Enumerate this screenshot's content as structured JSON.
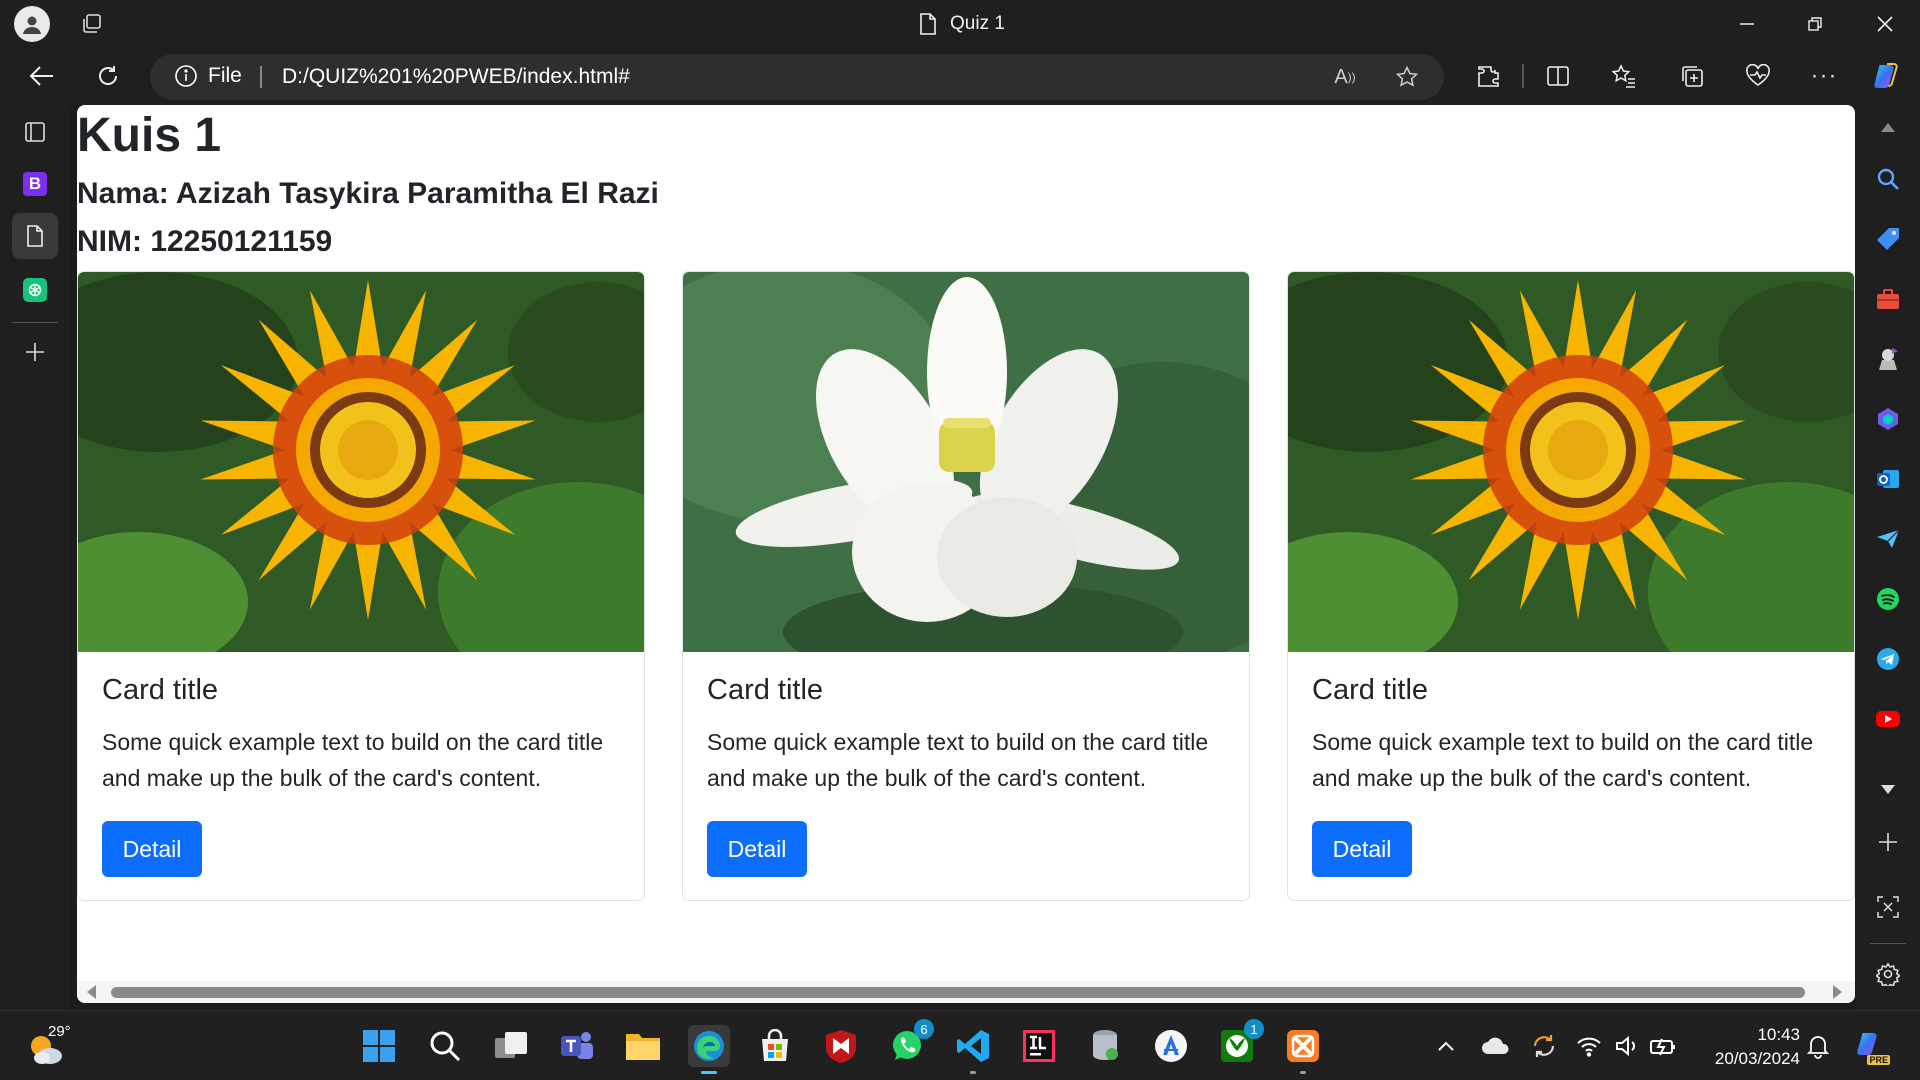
{
  "window": {
    "title": "Quiz 1"
  },
  "address_bar": {
    "scheme_label": "File",
    "url": "D:/QUIZ%201%20PWEB/index.html#"
  },
  "page": {
    "heading": "Kuis 1",
    "name_line": "Nama: Azizah Tasykira Paramitha El Razi",
    "nim_line": "NIM: 12250121159",
    "cards": [
      {
        "image": "gazania-flower-photo",
        "title": "Card title",
        "text": "Some quick example text to build on the card title and make up the bulk of the card's content.",
        "button": "Detail"
      },
      {
        "image": "white-lotus-flower-photo",
        "title": "Card title",
        "text": "Some quick example text to build on the card title and make up the bulk of the card's content.",
        "button": "Detail"
      },
      {
        "image": "gazania-flower-photo",
        "title": "Card title",
        "text": "Some quick example text to build on the card title and make up the bulk of the card's content.",
        "button": "Detail"
      }
    ]
  },
  "left_tabs": [
    {
      "icon": "tab-actions-icon"
    },
    {
      "icon": "bootstrap-tab-icon",
      "label": "B"
    },
    {
      "icon": "quiz-page-tab-icon",
      "active": true
    },
    {
      "icon": "chatgpt-tab-icon"
    },
    {
      "icon": "new-tab-plus-icon"
    }
  ],
  "right_sidebar": [
    "search-icon",
    "shopping-tag-icon",
    "tools-icon",
    "games-icon",
    "copilot-icon",
    "outlook-icon",
    "send-icon",
    "spotify-icon",
    "telegram-icon",
    "youtube-icon",
    "scroll-down-icon",
    "add-app-icon",
    "screenshot-icon",
    "settings-icon"
  ],
  "taskbar": {
    "weather_temp": "29°",
    "whatsapp_badge": "6",
    "xbox_badge": "1",
    "time": "10:43",
    "date": "20/03/2024",
    "copilot_label": "PRE"
  },
  "colors": {
    "primary_button": "#0d6efd",
    "browser_chrome": "#1f1f1f",
    "text": "#212529"
  }
}
